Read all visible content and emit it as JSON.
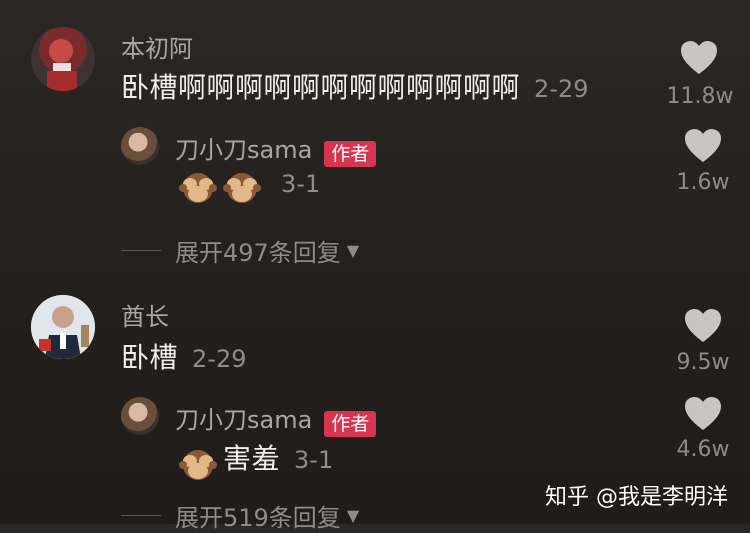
{
  "comments": [
    {
      "user": "本初阿",
      "text": "卧槽啊啊啊啊啊啊啊啊啊啊啊啊",
      "date": "2-29",
      "likes": "11.8w",
      "reply": {
        "user": "刀小刀sama",
        "badge": "作者",
        "text": "",
        "date": "3-1",
        "likes": "1.6w"
      },
      "expand_label": "展开497条回复"
    },
    {
      "user": "酋长",
      "text": "卧槽",
      "date": "2-29",
      "likes": "9.5w",
      "reply": {
        "user": "刀小刀sama",
        "badge": "作者",
        "text": "害羞",
        "date": "3-1",
        "likes": "4.6w"
      },
      "expand_label": "展开519条回复"
    }
  ],
  "watermark": "知乎 @我是李明洋",
  "icons": {
    "heart": "heart-icon",
    "emoji": "see-no-evil-monkey-emoji",
    "expand": "triangle-down-icon"
  },
  "colors": {
    "badge": "#d9344f",
    "heart": "#c9c5c1"
  }
}
